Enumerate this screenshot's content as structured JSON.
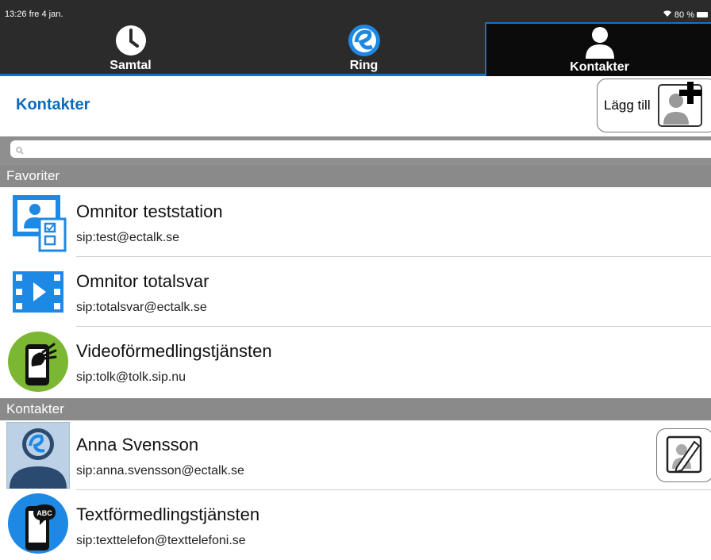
{
  "status_bar": {
    "time": "13:26  fre 4 jan.",
    "battery": "80 %"
  },
  "tabs": [
    {
      "label": "Samtal",
      "icon": "clock-icon"
    },
    {
      "label": "Ring",
      "icon": "ectalk-logo-icon"
    },
    {
      "label": "Kontakter",
      "icon": "person-icon",
      "selected": true
    }
  ],
  "header": {
    "title": "Kontakter",
    "add_label": "Lägg till"
  },
  "search": {
    "placeholder": ""
  },
  "sections": [
    {
      "title": "Favoriter",
      "items": [
        {
          "name": "Omnitor teststation",
          "address": "sip:test@ectalk.se",
          "icon": "teststation-icon"
        },
        {
          "name": "Omnitor totalsvar",
          "address": "sip:totalsvar@ectalk.se",
          "icon": "video-film-icon"
        },
        {
          "name": "Videoförmedlingstjänsten",
          "address": "sip:tolk@tolk.sip.nu",
          "icon": "sign-language-phone-icon"
        }
      ]
    },
    {
      "title": "Kontakter",
      "items": [
        {
          "name": "Anna Svensson",
          "address": "sip:anna.svensson@ectalk.se",
          "icon": "contact-avatar-icon"
        },
        {
          "name": "Textförmedlingstjänsten",
          "address": "sip:texttelefon@texttelefoni.se",
          "icon": "abc-phone-icon"
        }
      ]
    }
  ],
  "colors": {
    "accent": "#0d6ab8",
    "topbar": "#2b2b2b",
    "section": "#8a8a8a",
    "green": "#7cb733",
    "blue": "#1e88e5"
  }
}
